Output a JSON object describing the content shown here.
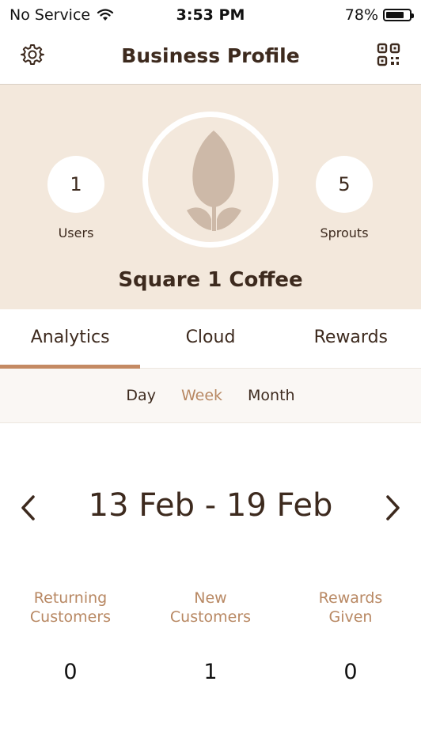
{
  "status_bar": {
    "carrier": "No Service",
    "time": "3:53 PM",
    "battery": "78%",
    "battery_level": 0.78
  },
  "nav": {
    "title": "Business Profile",
    "left_icon": "gear-icon",
    "right_icon": "qr-code-icon"
  },
  "profile": {
    "users_count": "1",
    "users_label": "Users",
    "sprouts_count": "5",
    "sprouts_label": "Sprouts",
    "business_name": "Square 1 Coffee",
    "avatar_icon": "sprout-leaf-icon"
  },
  "tabs": [
    {
      "label": "Analytics",
      "active": true
    },
    {
      "label": "Cloud",
      "active": false
    },
    {
      "label": "Rewards",
      "active": false
    }
  ],
  "periods": [
    {
      "label": "Day",
      "active": false
    },
    {
      "label": "Week",
      "active": true
    },
    {
      "label": "Month",
      "active": false
    }
  ],
  "date_range": "13 Feb - 19 Feb",
  "metrics": [
    {
      "label": "Returning Customers",
      "value": "0"
    },
    {
      "label": "New Customers",
      "value": "1"
    },
    {
      "label": "Rewards Given",
      "value": "0"
    }
  ],
  "colors": {
    "header_bg": "#f3e8dc",
    "text_dark": "#3d2a1e",
    "accent": "#c48a63",
    "accent_text": "#b88863"
  }
}
